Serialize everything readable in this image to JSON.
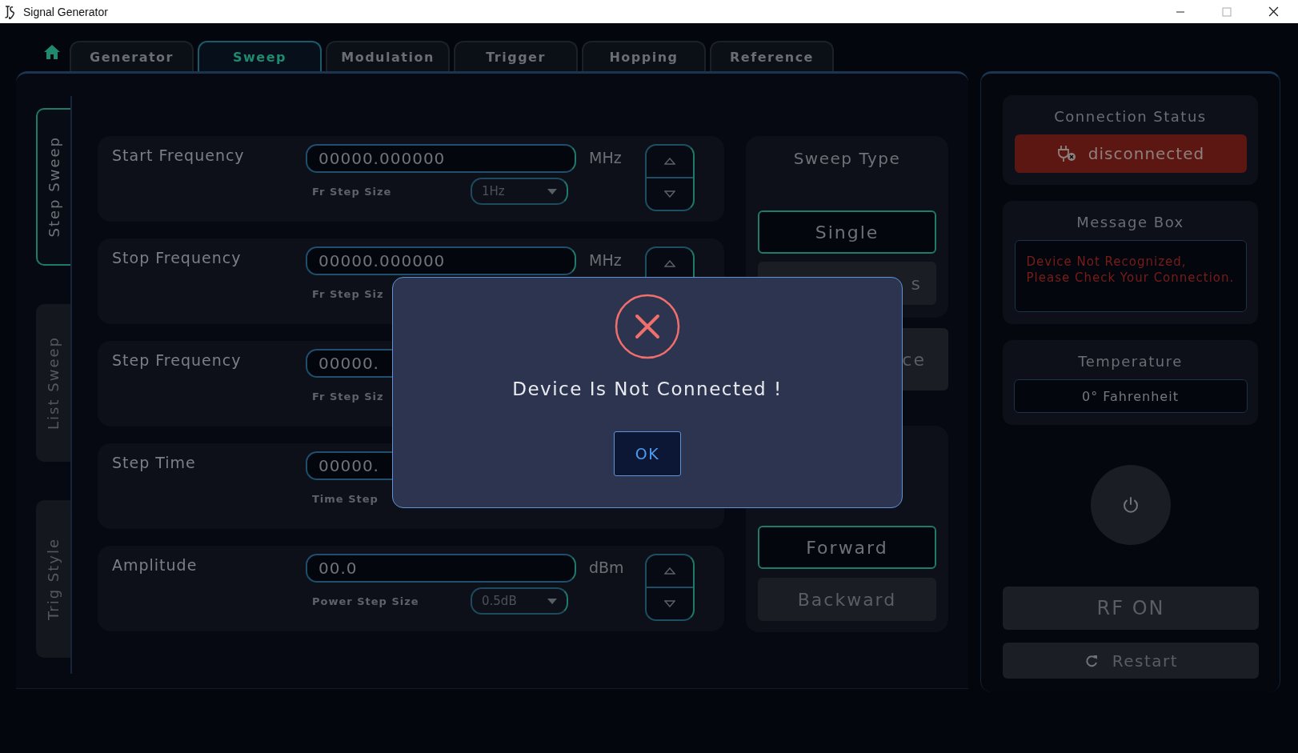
{
  "window": {
    "title": "Signal Generator"
  },
  "tabs": [
    {
      "label": "Generator",
      "selected": false
    },
    {
      "label": "Sweep",
      "selected": true
    },
    {
      "label": "Modulation",
      "selected": false
    },
    {
      "label": "Trigger",
      "selected": false
    },
    {
      "label": "Hopping",
      "selected": false
    },
    {
      "label": "Reference",
      "selected": false
    }
  ],
  "side_tabs": [
    {
      "label": "Step Sweep",
      "selected": true
    },
    {
      "label": "List Sweep",
      "selected": false
    },
    {
      "label": "Trig Style",
      "selected": false
    }
  ],
  "rows": [
    {
      "label": "Start Frequency",
      "value": "00000.000000",
      "unit": "MHz",
      "step_label": "Fr Step Size",
      "step_value": "1Hz"
    },
    {
      "label": "Stop Frequency",
      "value": "00000.000000",
      "unit": "MHz",
      "step_label": "Fr Step Siz"
    },
    {
      "label": "Step Frequency",
      "value": "00000.",
      "step_label": "Fr Step Siz"
    },
    {
      "label": "Step Time",
      "value": "00000.",
      "step_label": "Time Step"
    },
    {
      "label": "Amplitude",
      "value": "00.0",
      "unit": "dBm",
      "step_label": "Power Step Size",
      "step_value": "0.5dB"
    }
  ],
  "sweep_type": {
    "title": "Sweep Type",
    "options": [
      {
        "label": "Single",
        "selected": true
      },
      {
        "label": "s",
        "selected": false
      }
    ]
  },
  "button_3": {
    "label": "ce"
  },
  "direction": {
    "options": [
      {
        "label": "Forward",
        "selected": true
      },
      {
        "label": "Backward",
        "selected": false
      }
    ]
  },
  "connection": {
    "title": "Connection Status",
    "status": "disconnected",
    "connected": false
  },
  "message_box": {
    "title": "Message Box",
    "text": "Device Not Recognized, Please Check Your Connection."
  },
  "temperature": {
    "title": "Temperature",
    "value": "0° Fahrenheit"
  },
  "rf_button": {
    "label": "RF ON"
  },
  "restart_button": {
    "label": "Restart"
  },
  "dialog": {
    "message": "Device Is Not Connected !",
    "button": "OK"
  }
}
